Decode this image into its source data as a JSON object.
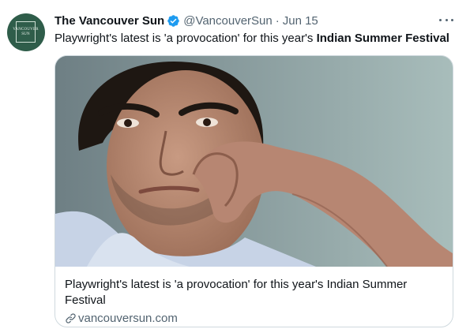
{
  "tweet": {
    "avatar_text": [
      "VANCOUVER",
      "SUN"
    ],
    "display_name": "The Vancouver Sun",
    "handle": "@VancouverSun",
    "separator": "·",
    "date": "Jun 15",
    "text_plain": "Playwright's latest is 'a provocation' for this year's ",
    "text_bold": "Indian Summer Festival"
  },
  "card": {
    "title": "Playwright's latest is 'a provocation' for this year's Indian Summer Festival",
    "domain": "vancouversun.com"
  },
  "icons": {
    "verified": "verified-badge-icon",
    "more": "more-options-icon",
    "link": "link-icon"
  },
  "colors": {
    "accent": "#1d9bf0",
    "secondary_text": "#536471",
    "border": "#cfd9de",
    "avatar_bg": "#2f5d4a"
  }
}
